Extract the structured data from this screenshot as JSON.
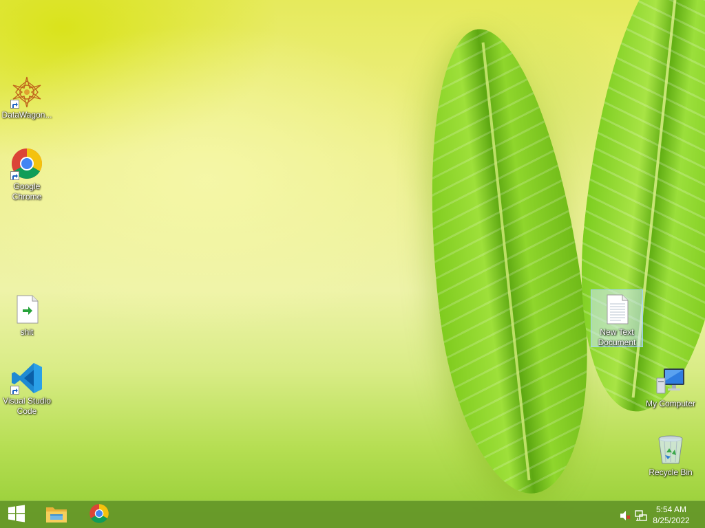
{
  "desktop": {
    "icons": [
      {
        "label": "DataWagon...",
        "icon": "datawagon-icon"
      },
      {
        "label": "Google Chrome",
        "icon": "chrome-icon"
      },
      {
        "label": "shit",
        "icon": "script-file-icon"
      },
      {
        "label": "Visual Studio Code",
        "icon": "vscode-icon"
      },
      {
        "label": "New Text Document",
        "icon": "text-document-icon"
      },
      {
        "label": "My Computer",
        "icon": "computer-icon"
      },
      {
        "label": "Recycle Bin",
        "icon": "recycle-bin-icon"
      }
    ]
  },
  "taskbar": {
    "pinned": [
      {
        "icon": "windows-start-icon"
      },
      {
        "icon": "file-explorer-icon"
      },
      {
        "icon": "chrome-icon"
      }
    ],
    "tray": {
      "icons": [
        "speaker-muted-icon",
        "network-icon"
      ],
      "time": "5:54 AM",
      "date": "8/25/2022"
    }
  },
  "colors": {
    "taskbar": "#64962a",
    "selection": "#cde8ff",
    "chrome_red": "#db4437",
    "chrome_yellow": "#f4c20d",
    "chrome_green": "#0f9d58",
    "chrome_blue": "#4285f4",
    "vscode_blue": "#007acc"
  }
}
